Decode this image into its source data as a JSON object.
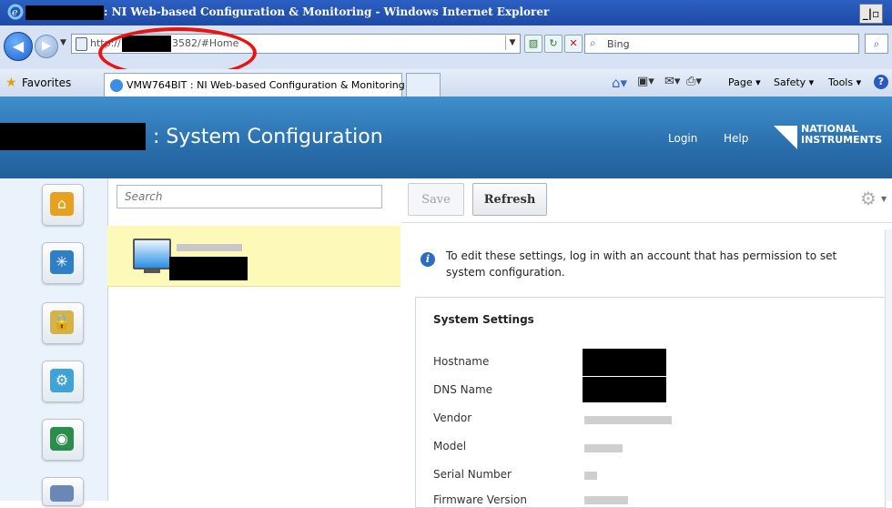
{
  "window": {
    "title": ": NI Web-based Configuration & Monitoring - Windows Internet Explorer",
    "restore_label": "_|\u0001"
  },
  "browser": {
    "url_prefix": "http://",
    "url_suffix": "3582/#Home",
    "search_placeholder": "Bing",
    "favorites_label": "Favorites",
    "tab_title": "VMW764BIT : NI Web-based Configuration & Monitoring",
    "commands": {
      "page": "Page ▾",
      "safety": "Safety ▾",
      "tools": "Tools ▾"
    }
  },
  "header": {
    "title": ": System Configuration",
    "login": "Login",
    "help": "Help",
    "logo_line1": "NATIONAL",
    "logo_line2": "INSTRUMENTS"
  },
  "sidebar": {
    "items": [
      {
        "name": "home",
        "icon": "home-icon"
      },
      {
        "name": "network",
        "icon": "network-icon"
      },
      {
        "name": "security",
        "icon": "lock-key-icon"
      },
      {
        "name": "tools",
        "icon": "wrench-globe-icon"
      },
      {
        "name": "web-server",
        "icon": "globe-computer-icon"
      },
      {
        "name": "more",
        "icon": "window-icon"
      }
    ]
  },
  "tree": {
    "search_placeholder": "Search"
  },
  "toolbar": {
    "save_label": "Save",
    "refresh_label": "Refresh"
  },
  "main": {
    "info_message": "To edit these settings, log in with an account that has permission to set system configuration.",
    "card_title": "System Settings",
    "properties": [
      {
        "label": "Hostname"
      },
      {
        "label": "DNS Name"
      },
      {
        "label": "Vendor"
      },
      {
        "label": "Model"
      },
      {
        "label": "Serial Number"
      },
      {
        "label": "Firmware Version"
      }
    ]
  },
  "colors": {
    "header_blue": "#2a6fae",
    "selection_yellow": "#fdfab9",
    "annotation_red": "#e11111"
  }
}
